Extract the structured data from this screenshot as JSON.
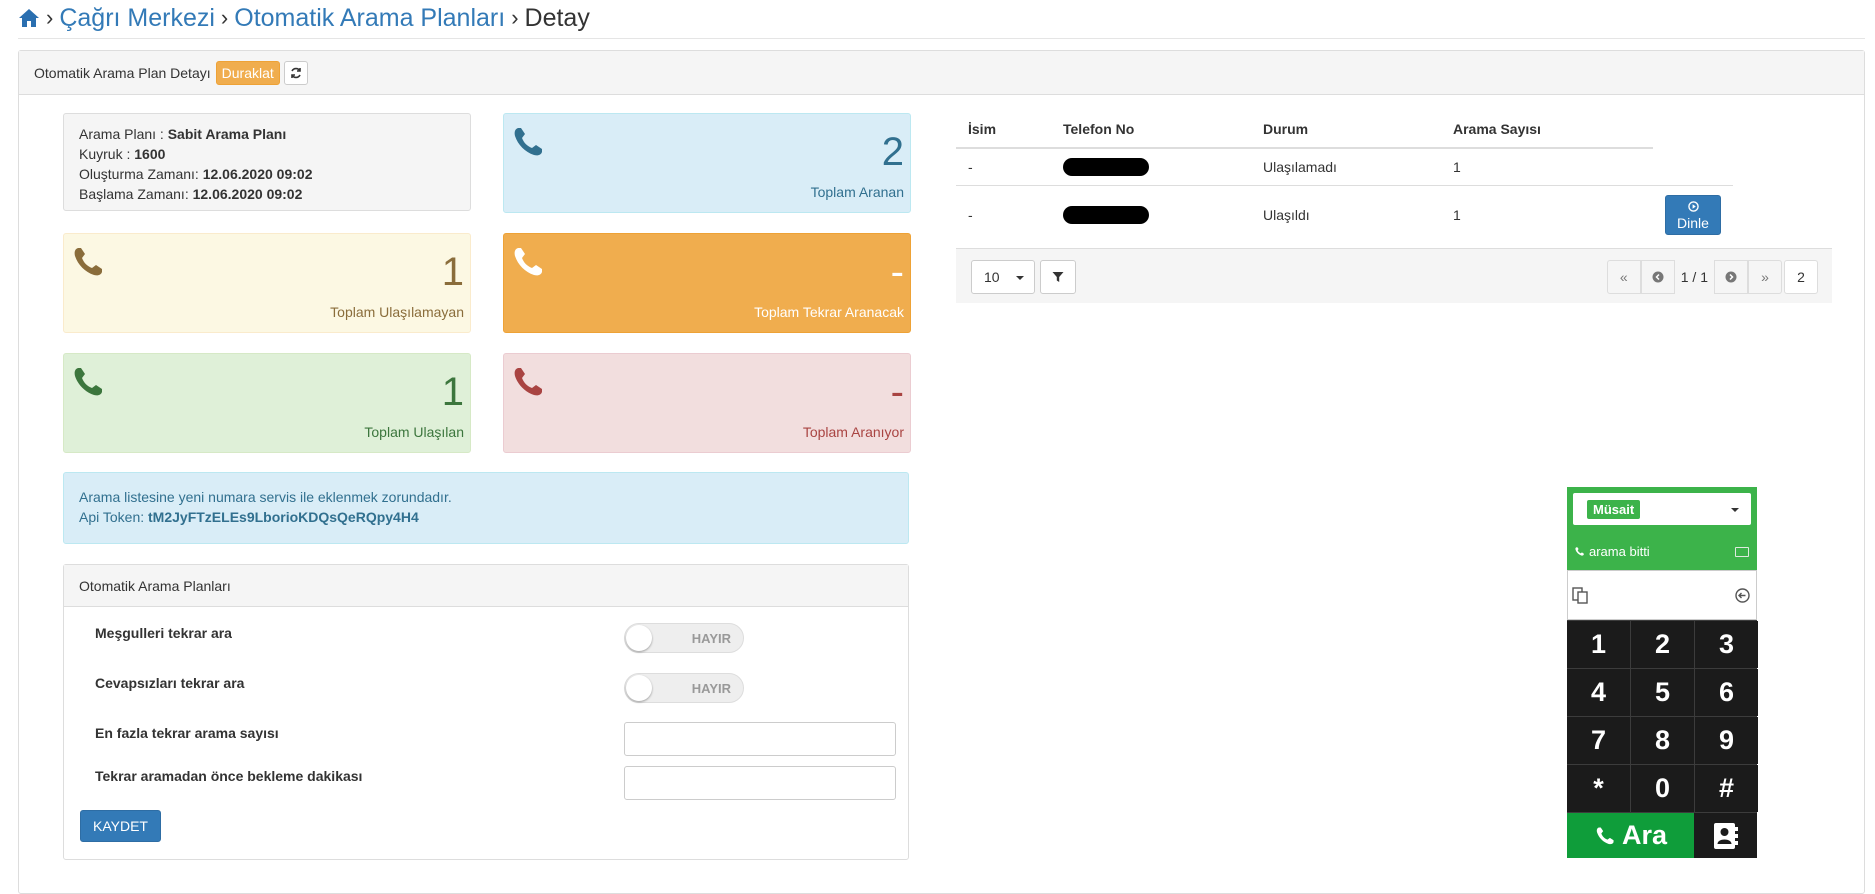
{
  "breadcrumb": {
    "home_icon": "home-icon",
    "items": [
      "Çağrı Merkezi",
      "Otomatik Arama Planları"
    ],
    "current": "Detay"
  },
  "panel": {
    "title": "Otomatik Arama Plan Detayı",
    "pause_label": "Duraklat",
    "refresh_icon": "refresh-icon"
  },
  "info": {
    "plan_label": "Arama Planı :",
    "plan_value": "Sabit Arama Planı",
    "queue_label": "Kuyruk :",
    "queue_value": "1600",
    "created_label": "Oluşturma Zamanı:",
    "created_value": "12.06.2020 09:02",
    "start_label": "Başlama Zamanı:",
    "start_value": "12.06.2020 09:02"
  },
  "stats": {
    "called": {
      "value": "2",
      "label": "Toplam Aranan"
    },
    "unreached": {
      "value": "1",
      "label": "Toplam Ulaşılamayan"
    },
    "to_recall": {
      "value": "-",
      "label": "Toplam Tekrar Aranacak"
    },
    "reached": {
      "value": "1",
      "label": "Toplam Ulaşılan"
    },
    "calling": {
      "value": "-",
      "label": "Toplam Aranıyor"
    }
  },
  "notice": {
    "text": "Arama listesine yeni numara servis ile eklenmek zorundadır.",
    "token_label": "Api Token:",
    "token_value": "tM2JyFTzELEs9LborioKDQsQeRQpy4H4"
  },
  "settings": {
    "title": "Otomatik Arama Planları",
    "busy_label": "Meşgulleri tekrar ara",
    "busy_toggle": "HAYIR",
    "noanswer_label": "Cevapsızları tekrar ara",
    "noanswer_toggle": "HAYIR",
    "max_label": "En fazla tekrar arama sayısı",
    "max_value": "",
    "wait_label": "Tekrar aramadan önce bekleme dakikası",
    "wait_value": "",
    "save_label": "KAYDET"
  },
  "table": {
    "headers": [
      "İsim",
      "Telefon No",
      "Durum",
      "Arama Sayısı"
    ],
    "rows": [
      {
        "name": "-",
        "status": "Ulaşılamadı",
        "count": "1"
      },
      {
        "name": "-",
        "status": "Ulaşıldı",
        "count": "1",
        "action": "Dinle"
      }
    ],
    "page_size": "10",
    "page_info": "1 / 1",
    "total": "2"
  },
  "phone": {
    "status": "Müsait",
    "info": "arama bitti",
    "keys": [
      "1",
      "2",
      "3",
      "4",
      "5",
      "6",
      "7",
      "8",
      "9",
      "*",
      "0",
      "#"
    ],
    "call_label": "Ara"
  },
  "colors": {
    "primary": "#337ab7",
    "warning": "#f0ad4e",
    "success_green": "#3cb34a",
    "call_green": "#0f9d3a"
  }
}
